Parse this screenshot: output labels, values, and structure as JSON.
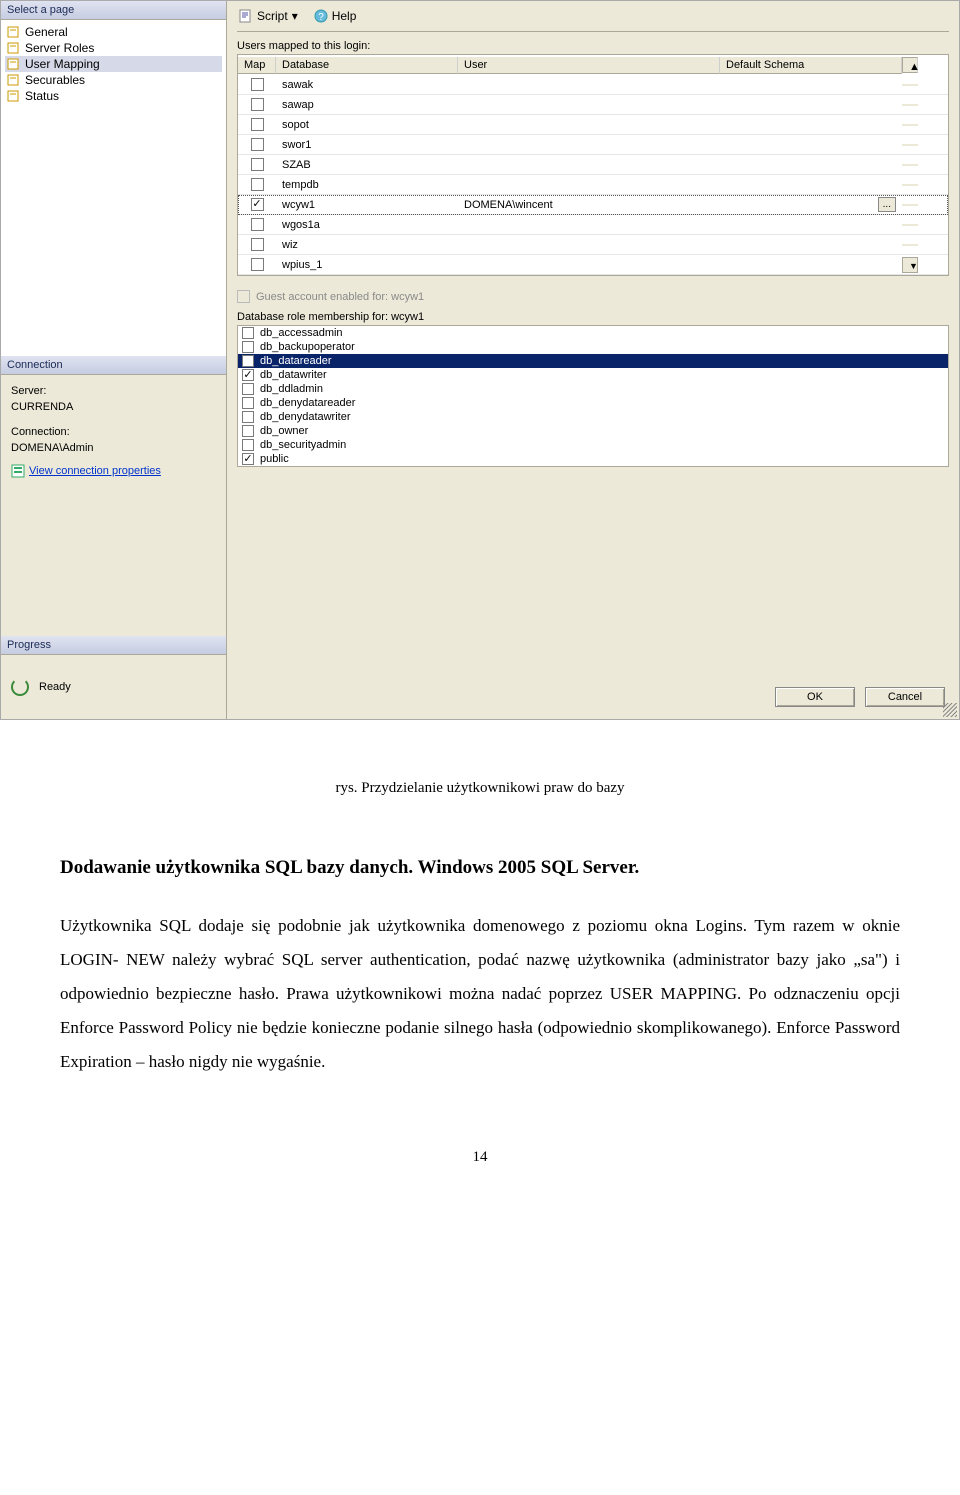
{
  "sidebar": {
    "header": "Select a page",
    "pages": [
      {
        "label": "General"
      },
      {
        "label": "Server Roles"
      },
      {
        "label": "User Mapping",
        "selected": true
      },
      {
        "label": "Securables"
      },
      {
        "label": "Status"
      }
    ],
    "connection_header": "Connection",
    "server_label": "Server:",
    "server_value": "CURRENDA",
    "connection_label": "Connection:",
    "connection_value": "DOMENA\\Admin",
    "view_props": "View connection properties",
    "progress_header": "Progress",
    "progress_status": "Ready"
  },
  "toolbar": {
    "script": "Script",
    "help": "Help"
  },
  "mapping": {
    "label": "Users mapped to this login:",
    "columns": {
      "map": "Map",
      "database": "Database",
      "user": "User",
      "schema": "Default Schema"
    },
    "rows": [
      {
        "checked": false,
        "db": "sawak",
        "user": "",
        "schema": ""
      },
      {
        "checked": false,
        "db": "sawap",
        "user": "",
        "schema": ""
      },
      {
        "checked": false,
        "db": "sopot",
        "user": "",
        "schema": ""
      },
      {
        "checked": false,
        "db": "swor1",
        "user": "",
        "schema": ""
      },
      {
        "checked": false,
        "db": "SZAB",
        "user": "",
        "schema": ""
      },
      {
        "checked": false,
        "db": "tempdb",
        "user": "",
        "schema": ""
      },
      {
        "checked": true,
        "db": "wcyw1",
        "user": "DOMENA\\wincent",
        "schema": "",
        "selected": true,
        "ellipsis": true
      },
      {
        "checked": false,
        "db": "wgos1a",
        "user": "",
        "schema": ""
      },
      {
        "checked": false,
        "db": "wiz",
        "user": "",
        "schema": ""
      },
      {
        "checked": false,
        "db": "wpius_1",
        "user": "",
        "schema": ""
      }
    ]
  },
  "guest_label": "Guest account enabled for: wcyw1",
  "roles_label": "Database role membership for: wcyw1",
  "roles": [
    {
      "name": "db_accessadmin",
      "checked": false
    },
    {
      "name": "db_backupoperator",
      "checked": false
    },
    {
      "name": "db_datareader",
      "checked": true,
      "selected": true
    },
    {
      "name": "db_datawriter",
      "checked": true
    },
    {
      "name": "db_ddladmin",
      "checked": false
    },
    {
      "name": "db_denydatareader",
      "checked": false
    },
    {
      "name": "db_denydatawriter",
      "checked": false
    },
    {
      "name": "db_owner",
      "checked": false
    },
    {
      "name": "db_securityadmin",
      "checked": false
    },
    {
      "name": "public",
      "checked": true
    }
  ],
  "buttons": {
    "ok": "OK",
    "cancel": "Cancel"
  },
  "doc": {
    "caption": "rys. Przydzielanie użytkownikowi praw do bazy",
    "heading": "Dodawanie  użytkownika SQL  bazy  danych.  Windows 2005 SQL Server.",
    "paragraph": "Użytkownika  SQL  dodaje się  podobnie jak użytkownika domenowego z  poziomu okna Logins. Tym razem w  oknie  LOGIN- NEW    należy wybrać  SQL  server authentication, podać nazwę użytkownika (administrator bazy jako „sa\")  i odpowiednio bezpieczne hasło. Prawa  użytkownikowi można  nadać  poprzez USER MAPPING. Po odznaczeniu  opcji  Enforce Password Policy  nie będzie konieczne podanie silnego hasła (odpowiednio skomplikowanego). Enforce  Password Expiration – hasło nigdy nie  wygaśnie.",
    "pagenum": "14"
  }
}
